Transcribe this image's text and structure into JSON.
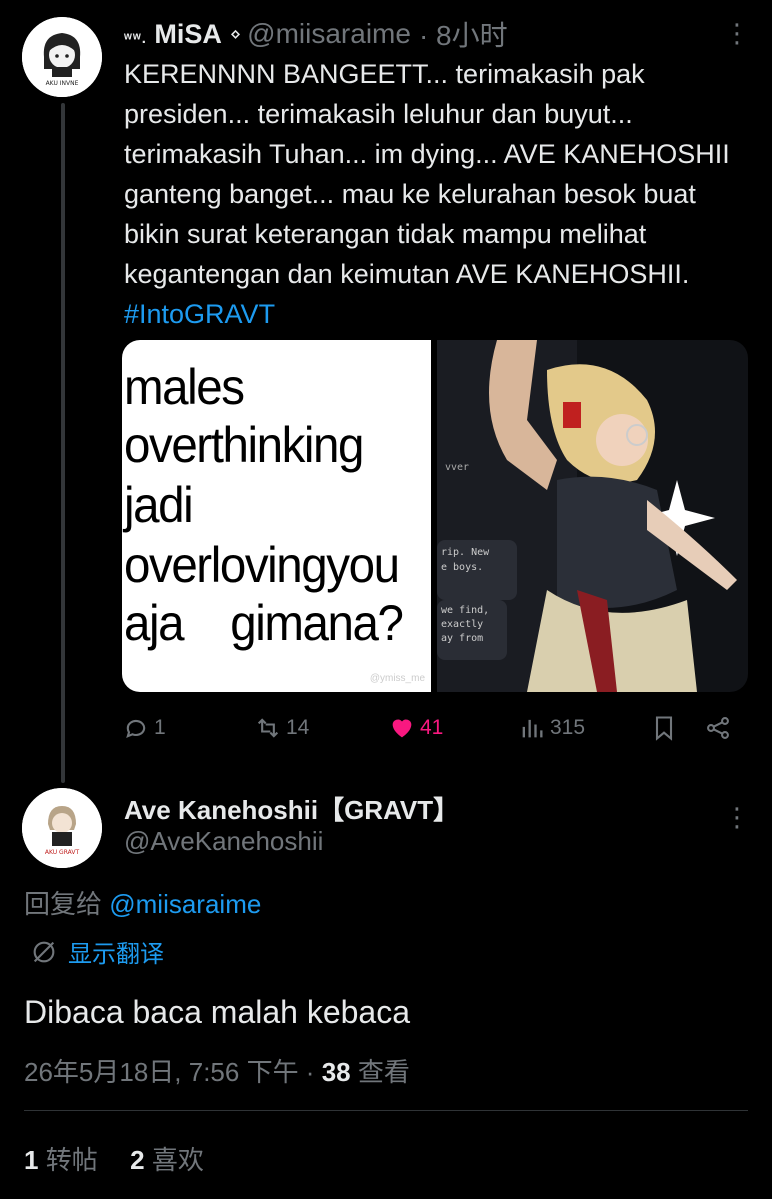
{
  "tweet": {
    "author_name_prefix": "ʷʷ.",
    "author_name": "MiSA",
    "author_badge": "⋄",
    "handle": "@miisaraime",
    "time": "· 8小时",
    "avatar_text": "AKU INVNE",
    "text": "KERENNNN BANGEETT... terimakasih pak presiden... terimakasih leluhur dan buyut... terimakasih Tuhan... im dying... AVE KANEHOSHII ganteng banget... mau ke kelurahan besok buat bikin surat keterangan tidak mampu melihat kegantengan dan keimutan AVE KANEHOSHII. ",
    "hashtag": "#IntoGRAVT",
    "meme_lines": [
      "males",
      "overthinking",
      "jadi",
      "overlovingyou",
      "aja    gimana?"
    ],
    "meme_watermark": "@ymiss_me",
    "art_texts": [
      "vver",
      "rip. New",
      "e boys.",
      "we find,",
      "exactly",
      "ay from"
    ],
    "actions": {
      "reply": "1",
      "retweet": "14",
      "like": "41",
      "views": "315"
    },
    "more": "⋮",
    "colors": {
      "like": "#f91880",
      "link": "#1d9bf0",
      "muted": "#71767b"
    }
  },
  "reply": {
    "author_name": "Ave Kanehoshii【GRAVT】",
    "handle": "@AveKanehoshii",
    "avatar_text": "AKU GRAVT",
    "replying_prefix": "回复给 ",
    "replying_to": "@miisaraime",
    "translate_label": "显示翻译",
    "text": "Dibaca baca malah kebaca",
    "timestamp": "26年5月18日, 7:56 下午 · ",
    "views_count": "38",
    "views_label": " 查看",
    "retweets_count": "1",
    "retweets_label": " 转帖",
    "likes_count": "2",
    "likes_label": " 喜欢",
    "more": "⋮"
  }
}
